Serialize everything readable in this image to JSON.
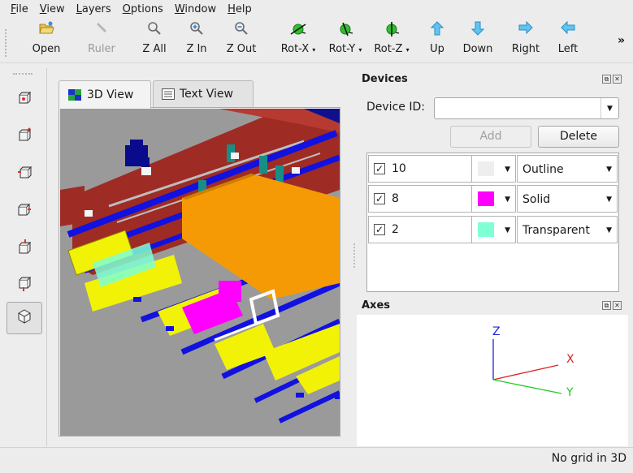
{
  "menubar": {
    "items": [
      {
        "underline": "F",
        "rest": "ile"
      },
      {
        "underline": "V",
        "rest": "iew"
      },
      {
        "underline": "L",
        "rest": "ayers"
      },
      {
        "underline": "O",
        "rest": "ptions"
      },
      {
        "underline": "W",
        "rest": "indow"
      },
      {
        "underline": "H",
        "rest": "elp"
      }
    ]
  },
  "toolbar": {
    "open": "Open",
    "ruler": "Ruler",
    "zall": "Z All",
    "zin": "Z In",
    "zout": "Z Out",
    "rotx": "Rot-X",
    "roty": "Rot-Y",
    "rotz": "Rot-Z",
    "up": "Up",
    "down": "Down",
    "right": "Right",
    "left": "Left",
    "more": "»"
  },
  "tabs": {
    "view3d": "3D View",
    "textview": "Text View"
  },
  "devices": {
    "title": "Devices",
    "device_id_label": "Device ID:",
    "device_id_value": "",
    "add": "Add",
    "delete": "Delete",
    "rows": [
      {
        "checked": "✓",
        "id": "10",
        "color": "#eeeeee",
        "mode": "Outline"
      },
      {
        "checked": "✓",
        "id": "8",
        "color": "#ff00ff",
        "mode": "Solid"
      },
      {
        "checked": "✓",
        "id": "2",
        "color": "#7fffd4",
        "mode": "Transparent"
      }
    ]
  },
  "axes": {
    "title": "Axes",
    "z": "Z",
    "x": "X",
    "y": "Y"
  },
  "status": {
    "text": "No grid in 3D"
  }
}
